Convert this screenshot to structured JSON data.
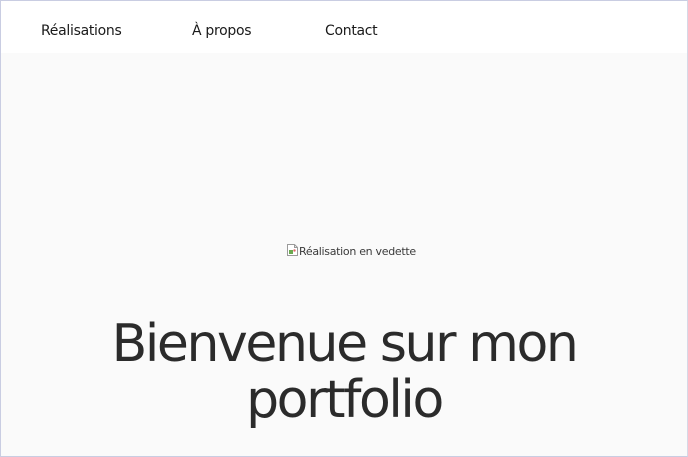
{
  "nav": {
    "items": [
      {
        "label": "Réalisations"
      },
      {
        "label": "À propos"
      },
      {
        "label": "Contact"
      }
    ]
  },
  "featured_image": {
    "alt": "Réalisation en vedette",
    "icon": "broken-image-icon"
  },
  "hero": {
    "title_line1": "Bienvenue sur mon",
    "title_line2": "portfolio"
  },
  "colors": {
    "background": "#fafafa",
    "text": "#2b2b2b",
    "frame_border": "#c9cde2"
  }
}
